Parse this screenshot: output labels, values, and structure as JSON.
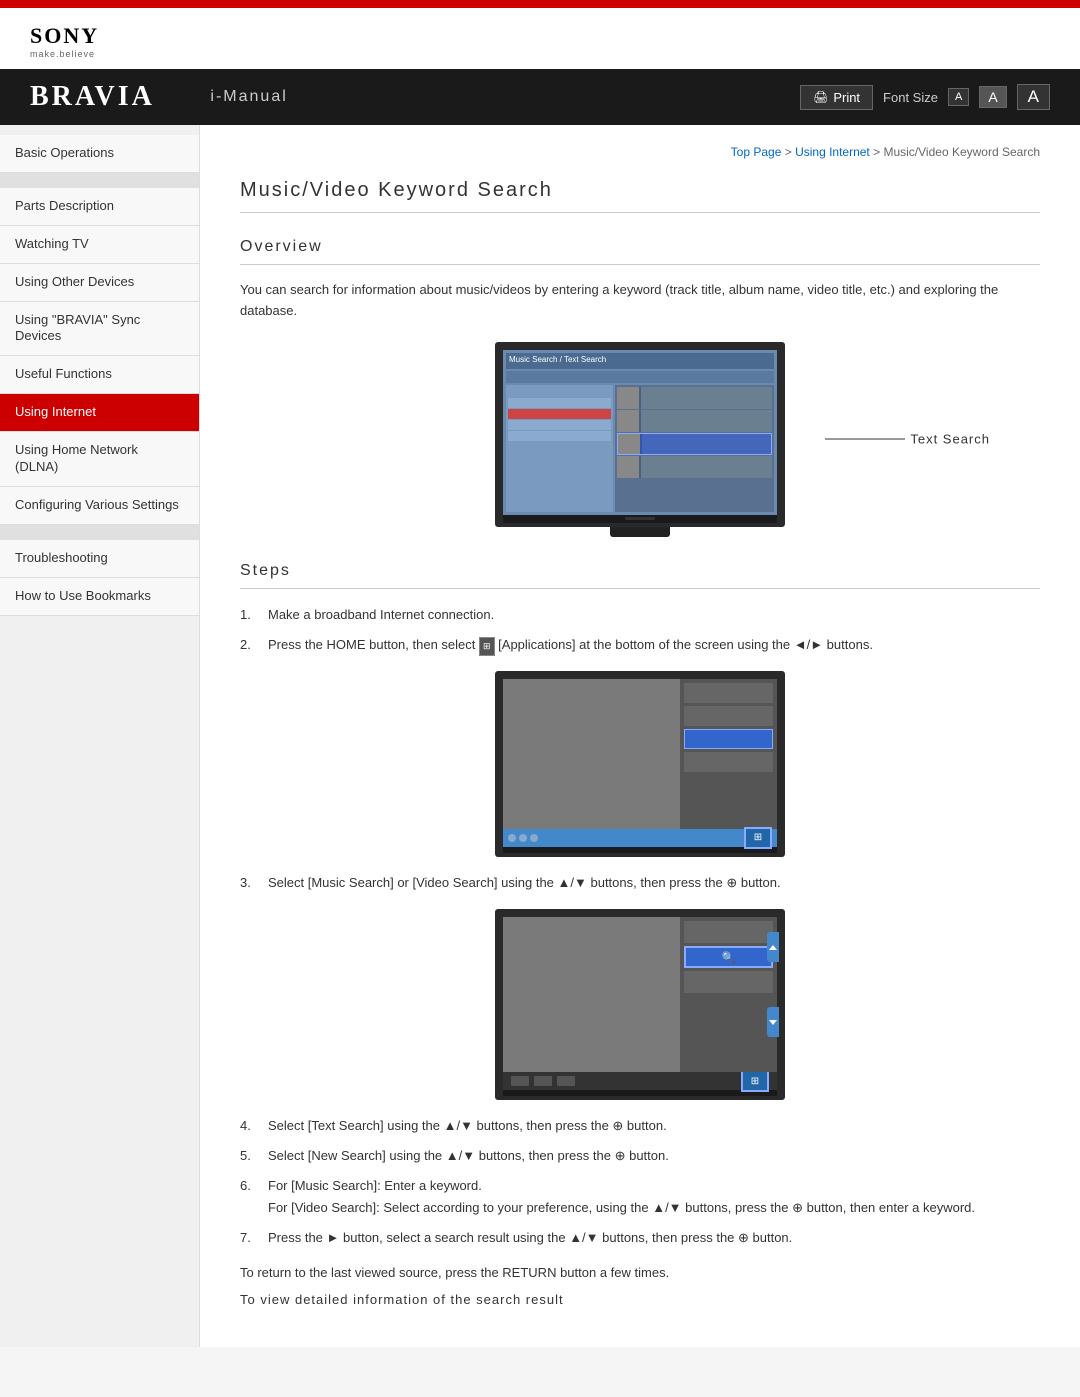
{
  "header": {
    "brand": "BRAVIA",
    "manual_title": "i-Manual",
    "print_label": "Print",
    "font_size_label": "Font Size",
    "font_small": "A",
    "font_medium": "A",
    "font_large": "A"
  },
  "sony": {
    "logo": "SONY",
    "tagline": "make.believe"
  },
  "breadcrumb": {
    "top_page": "Top Page",
    "separator1": " > ",
    "using_internet": "Using Internet",
    "separator2": " > ",
    "current": "Music/Video Keyword Search"
  },
  "sidebar": {
    "items": [
      {
        "id": "basic-operations",
        "label": "Basic Operations",
        "active": false
      },
      {
        "id": "parts-description",
        "label": "Parts Description",
        "active": false
      },
      {
        "id": "watching-tv",
        "label": "Watching TV",
        "active": false
      },
      {
        "id": "using-other-devices",
        "label": "Using Other Devices",
        "active": false
      },
      {
        "id": "using-bravia-sync",
        "label": "Using \"BRAVIA\" Sync Devices",
        "active": false
      },
      {
        "id": "useful-functions",
        "label": "Useful Functions",
        "active": false
      },
      {
        "id": "using-internet",
        "label": "Using Internet",
        "active": true
      },
      {
        "id": "using-home-network",
        "label": "Using Home Network (DLNA)",
        "active": false
      },
      {
        "id": "configuring-various-settings",
        "label": "Configuring Various Settings",
        "active": false
      },
      {
        "id": "troubleshooting",
        "label": "Troubleshooting",
        "active": false
      },
      {
        "id": "how-to-use-bookmarks",
        "label": "How to Use Bookmarks",
        "active": false
      }
    ]
  },
  "content": {
    "page_title": "Music/Video Keyword Search",
    "overview_heading": "Overview",
    "overview_text": "You can search for information about music/videos by entering a keyword (track title, album name, video title, etc.) and exploring the database.",
    "text_search_label": "Text Search",
    "steps_heading": "Steps",
    "steps": [
      {
        "num": "1.",
        "text": "Make a broadband Internet connection."
      },
      {
        "num": "2.",
        "text": "Press the HOME button, then select  [Applications] at the bottom of the screen using the ◄/► buttons."
      },
      {
        "num": "3.",
        "text": "Select [Music Search] or [Video Search] using the ▲/▼ buttons, then press the ⊕ button."
      },
      {
        "num": "4.",
        "text": "Select [Text Search] using the ▲/▼ buttons, then press the ⊕ button."
      },
      {
        "num": "5.",
        "text": "Select [New Search] using the ▲/▼ buttons, then press the ⊕ button."
      },
      {
        "num": "6.",
        "text": "For [Music Search]: Enter a keyword.\nFor [Video Search]: Select according to your preference, using the ▲/▼ buttons, press the ⊕ button, then enter a keyword."
      },
      {
        "num": "7.",
        "text": "Press the ► button, select a search result using the ▲/▼ buttons, then press the ⊕ button."
      }
    ],
    "return_text": "To return to the last viewed source, press the RETURN button a few times.",
    "view_detail": "To view detailed information of the search result"
  }
}
